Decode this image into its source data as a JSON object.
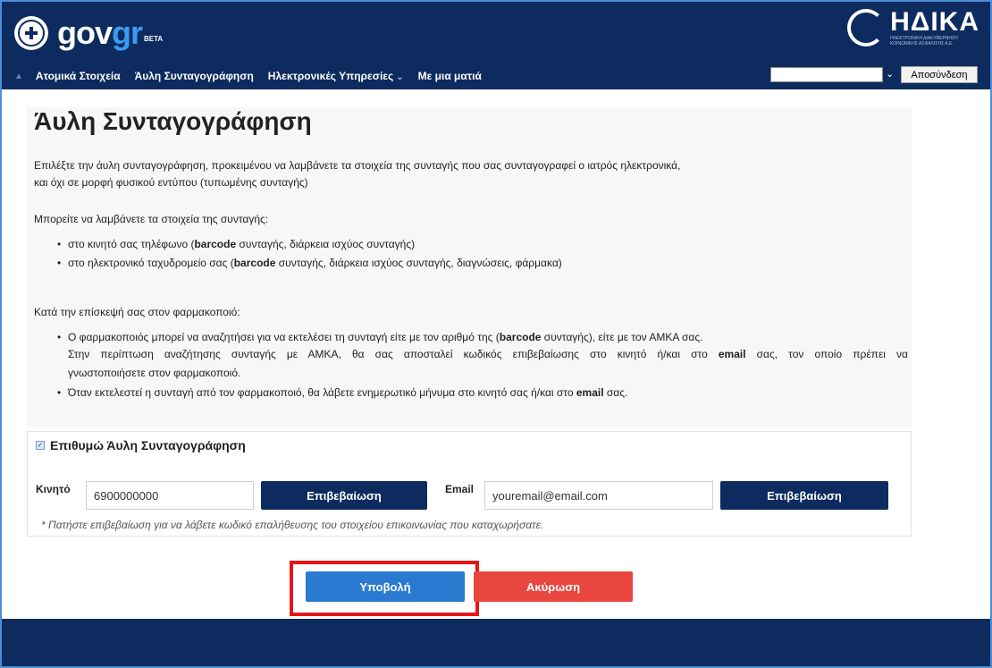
{
  "header": {
    "logo_prefix": "gov",
    "logo_suffix": "gr",
    "logo_beta": "BETA",
    "partner_title": "ΗΔΙΚΑ",
    "partner_subtitle_1": "ΗΛΕΚΤΡΟΝΙΚΗ ΔΙΑΚΥΒΕΡΝΗΣΗ",
    "partner_subtitle_2": "ΚΟΙΝΩΝΙΚΗΣ ΑΣΦΑΛΙΣΗΣ Α.Ε."
  },
  "nav": {
    "items": [
      "Ατομικά Στοιχεία",
      "Άυλη Συνταγογράφηση",
      "Ηλεκτρονικές Υπηρεσίες",
      "Με μια ματιά"
    ],
    "logout_label": "Αποσύνδεση"
  },
  "page": {
    "title": "Άυλη Συνταγογράφηση",
    "intro_line1": "Επιλέξτε την άυλη συνταγογράφηση, προκειμένου να λαμβάνετε τα στοιχεία της συνταγής που σας συνταγογραφεί ο ιατρός ηλεκτρονικά,",
    "intro_line2": "και όχι σε μορφή φυσικού εντύπου (τυπωμένης συνταγής)",
    "receive_heading": "Μπορείτε να λαμβάνετε τα στοιχεία της συνταγής:",
    "receive_1_pre": "στο κινητό σας τηλέφωνο (",
    "receive_1_bold": "barcode",
    "receive_1_post": " συνταγής, διάρκεια ισχύος συνταγής)",
    "receive_2_pre": "στο ηλεκτρονικό ταχυδρομείο σας (",
    "receive_2_bold": "barcode",
    "receive_2_post": " συνταγής, διάρκεια ισχύος συνταγής, διαγνώσεις, φάρμακα)",
    "pharmacy_heading": "Κατά την επίσκεψή σας στον φαρμακοποιό:",
    "pharmacy_1_pre": "Ο φαρμακοποιός μπορεί να αναζητήσει για να εκτελέσει τη συνταγή είτε με τον αριθμό της (",
    "pharmacy_1_bold": "barcode",
    "pharmacy_1_post": " συνταγής), είτε με τον ΑΜΚΑ σας.",
    "pharmacy_1b_pre": "Στην περίπτωση αναζήτησης συνταγής με ΑΜΚΑ, θα σας αποσταλεί κωδικός επιβεβαίωσης στο κινητό ή/και στο ",
    "pharmacy_1b_bold": "email",
    "pharmacy_1b_post": " σας, τον οποίο πρέπει να",
    "pharmacy_1c": "γνωστοποιήσετε στον φαρμακοποιό.",
    "pharmacy_2_pre": "Όταν εκτελεστεί η συνταγή από τον φαρμακοποιό, θα λάβετε ενημερωτικό μήνυμα στο κινητό σας ή/και στο ",
    "pharmacy_2_bold": "email",
    "pharmacy_2_post": " σας."
  },
  "form": {
    "checkbox_mark": "✓",
    "checkbox_label": "Επιθυμώ Άυλη Συνταγογράφηση",
    "mobile_label": "Κινητό",
    "mobile_value": "6900000000",
    "email_label": "Email",
    "email_value": "youremail@email.com",
    "confirm_label": "Επιβεβαίωση",
    "hint": "* Πατήστε επιβεβαίωση για να λάβετε κωδικό επαλήθευσης του στοιχείου επικοινωνίας που καταχωρήσατε."
  },
  "actions": {
    "submit_label": "Υποβολή",
    "cancel_label": "Ακύρωση"
  },
  "colors": {
    "header_bg": "#0d2b5e",
    "submit": "#2a7ad2",
    "cancel": "#e8463f",
    "highlight": "#e8141a"
  }
}
